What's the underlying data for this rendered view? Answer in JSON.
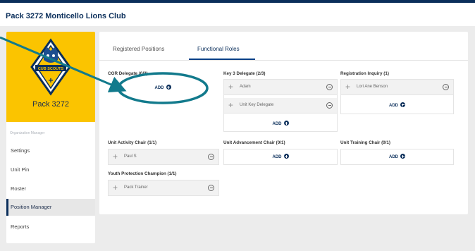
{
  "header": {
    "org_title": "Pack 3272 Monticello Lions Club"
  },
  "sidebar": {
    "pack_name": "Pack 3272",
    "logo_text": "CUB SCOUTS",
    "menu_header": "Organization Manager",
    "items": [
      {
        "label": "Settings",
        "active": false
      },
      {
        "label": "Unit Pin",
        "active": false
      },
      {
        "label": "Roster",
        "active": false
      },
      {
        "label": "Position Manager",
        "active": true
      },
      {
        "label": "Reports",
        "active": false
      }
    ]
  },
  "tabs": [
    {
      "label": "Registered Positions",
      "active": false
    },
    {
      "label": "Functional Roles",
      "active": true
    }
  ],
  "add_label": "ADD",
  "roles": {
    "cor_delegate": {
      "title": "COR Delegate (0/3)"
    },
    "key3_delegate": {
      "title": "Key 3 Delegate (2/3)",
      "members": [
        "Adam",
        "Unit Key Delegate"
      ]
    },
    "registration_inquiry": {
      "title": "Registration Inquiry (1)",
      "members": [
        "Lori Ane Benson"
      ]
    },
    "unit_activity_chair": {
      "title": "Unit Activity Chair (1/1)",
      "members": [
        "Paul S"
      ]
    },
    "unit_advancement_chair": {
      "title": "Unit Advancement Chair (0/1)"
    },
    "unit_training_chair": {
      "title": "Unit Training Chair (0/1)"
    },
    "youth_protection_champion": {
      "title": "Youth Protection Champion (1/1)",
      "members": [
        "Pack Trainer"
      ]
    }
  },
  "colors": {
    "brand_navy": "#0b2f5b",
    "logo_yellow": "#fbc400",
    "annotation_teal": "#127a8c"
  }
}
